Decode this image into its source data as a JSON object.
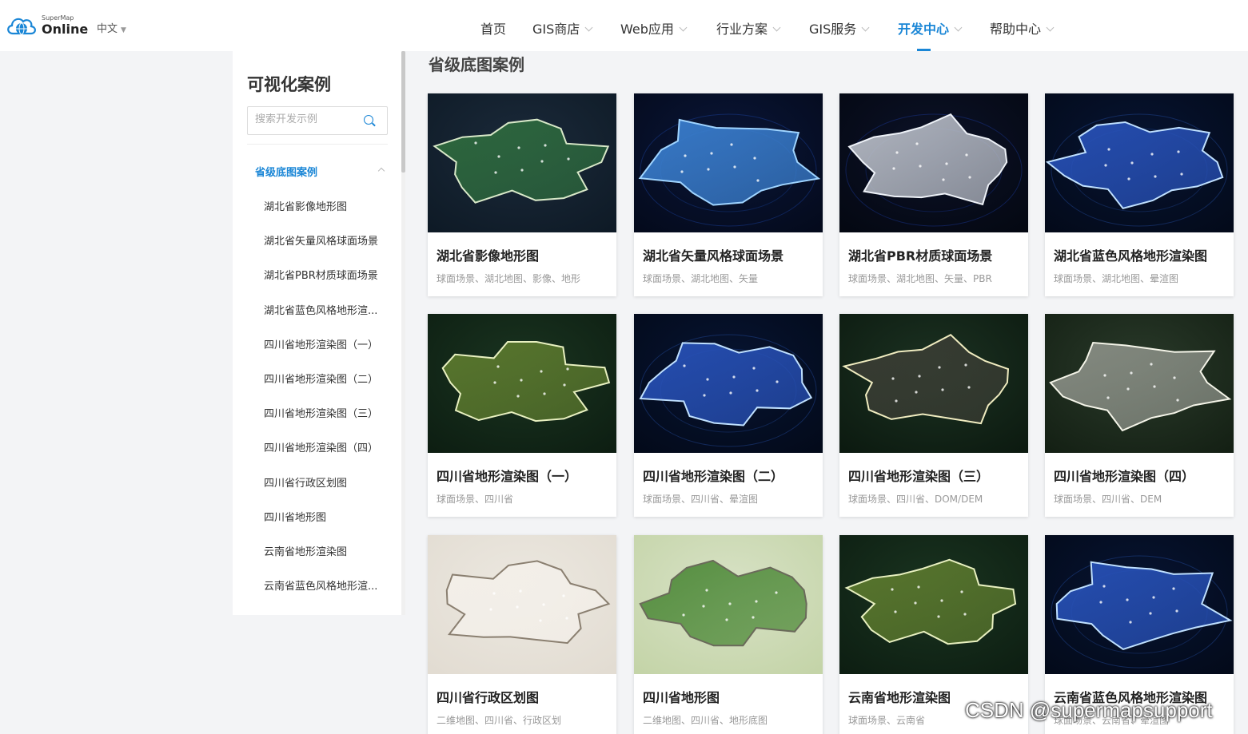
{
  "header": {
    "logo_small": "SuperMap",
    "logo_big": "Online",
    "lang": "中文",
    "nav": [
      {
        "label": "首页",
        "has_menu": false,
        "active": false
      },
      {
        "label": "GIS商店",
        "has_menu": true,
        "active": false
      },
      {
        "label": "Web应用",
        "has_menu": true,
        "active": false
      },
      {
        "label": "行业方案",
        "has_menu": true,
        "active": false
      },
      {
        "label": "GIS服务",
        "has_menu": true,
        "active": false
      },
      {
        "label": "开发中心",
        "has_menu": true,
        "active": true
      },
      {
        "label": "帮助中心",
        "has_menu": true,
        "active": false
      }
    ]
  },
  "sidebar": {
    "title": "可视化案例",
    "search_placeholder": "搜索开发示例",
    "group": "省级底图案例",
    "items": [
      "湖北省影像地形图",
      "湖北省矢量风格球面场景",
      "湖北省PBR材质球面场景",
      "湖北省蓝色风格地形渲...",
      "四川省地形渲染图（一）",
      "四川省地形渲染图（二）",
      "四川省地形渲染图（三）",
      "四川省地形渲染图（四）",
      "四川省行政区划图",
      "四川省地形图",
      "云南省地形渲染图",
      "云南省蓝色风格地形渲..."
    ]
  },
  "main": {
    "title": "省级底图案例",
    "cards": [
      {
        "title": "湖北省影像地形图",
        "tags": "球面场景、湖北地图、影像、地形",
        "theme": "satellite"
      },
      {
        "title": "湖北省矢量风格球面场景",
        "tags": "球面场景、湖北地图、矢量",
        "theme": "glow-blue"
      },
      {
        "title": "湖北省PBR材质球面场景",
        "tags": "球面场景、湖北地图、矢量、PBR",
        "theme": "silver"
      },
      {
        "title": "湖北省蓝色风格地形渲染图",
        "tags": "球面场景、湖北地图、晕渲图",
        "theme": "blue-terrain"
      },
      {
        "title": "四川省地形渲染图（一）",
        "tags": "球面场景、四川省",
        "theme": "green-terrain"
      },
      {
        "title": "四川省地形渲染图（二）",
        "tags": "球面场景、四川省、晕渲图",
        "theme": "blue-terrain"
      },
      {
        "title": "四川省地形渲染图（三）",
        "tags": "球面场景、四川省、DOM/DEM",
        "theme": "dark-terrain"
      },
      {
        "title": "四川省地形渲染图（四）",
        "tags": "球面场景、四川省、DEM",
        "theme": "white-terrain"
      },
      {
        "title": "四川省行政区划图",
        "tags": "二维地图、四川省、行政区划",
        "theme": "admin"
      },
      {
        "title": "四川省地形图",
        "tags": "二维地图、四川省、地形底图",
        "theme": "topo"
      },
      {
        "title": "云南省地形渲染图",
        "tags": "球面场景、云南省",
        "theme": "green-terrain"
      },
      {
        "title": "云南省蓝色风格地形渲染图",
        "tags": "球面场景、云南省、晕渲图",
        "theme": "blue-terrain"
      }
    ]
  },
  "watermark": "CSDN @supermapsupport"
}
